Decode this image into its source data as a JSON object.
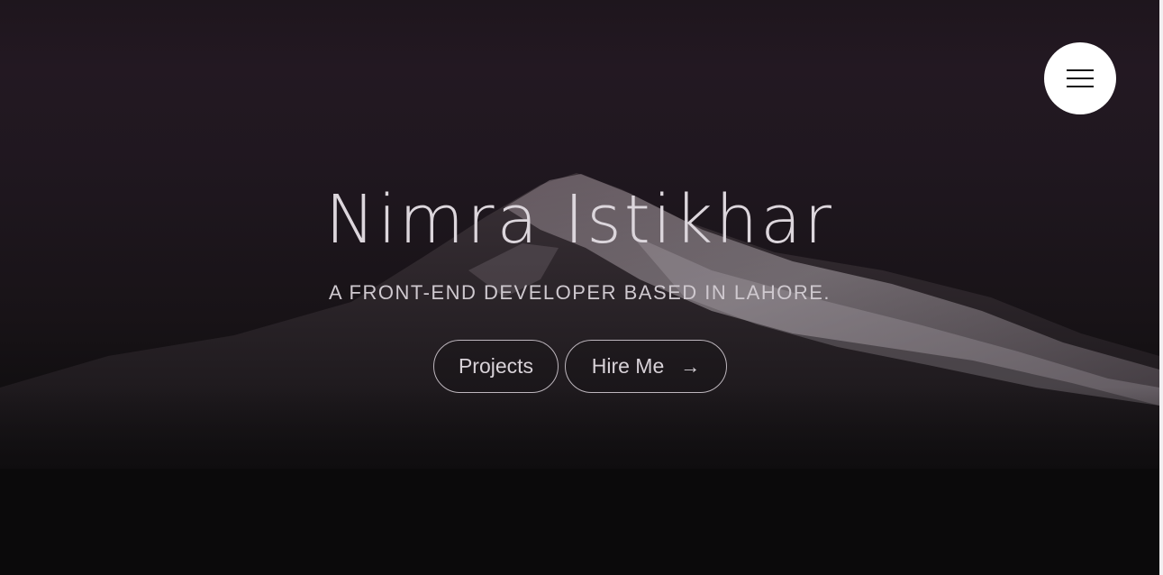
{
  "hero": {
    "name": "Nimra Istikhar",
    "tagline": "A FRONT-END DEVELOPER BASED IN LAHORE.",
    "buttons": {
      "projects": "Projects",
      "hire": "Hire Me",
      "hire_icon": "→"
    }
  },
  "nav": {
    "menu_icon": "hamburger-menu-icon"
  },
  "colors": {
    "background_dark": "#0c0b0c",
    "sky_tint": "#231822",
    "text": "#d8d2d8",
    "menu_button": "#ffffff"
  }
}
